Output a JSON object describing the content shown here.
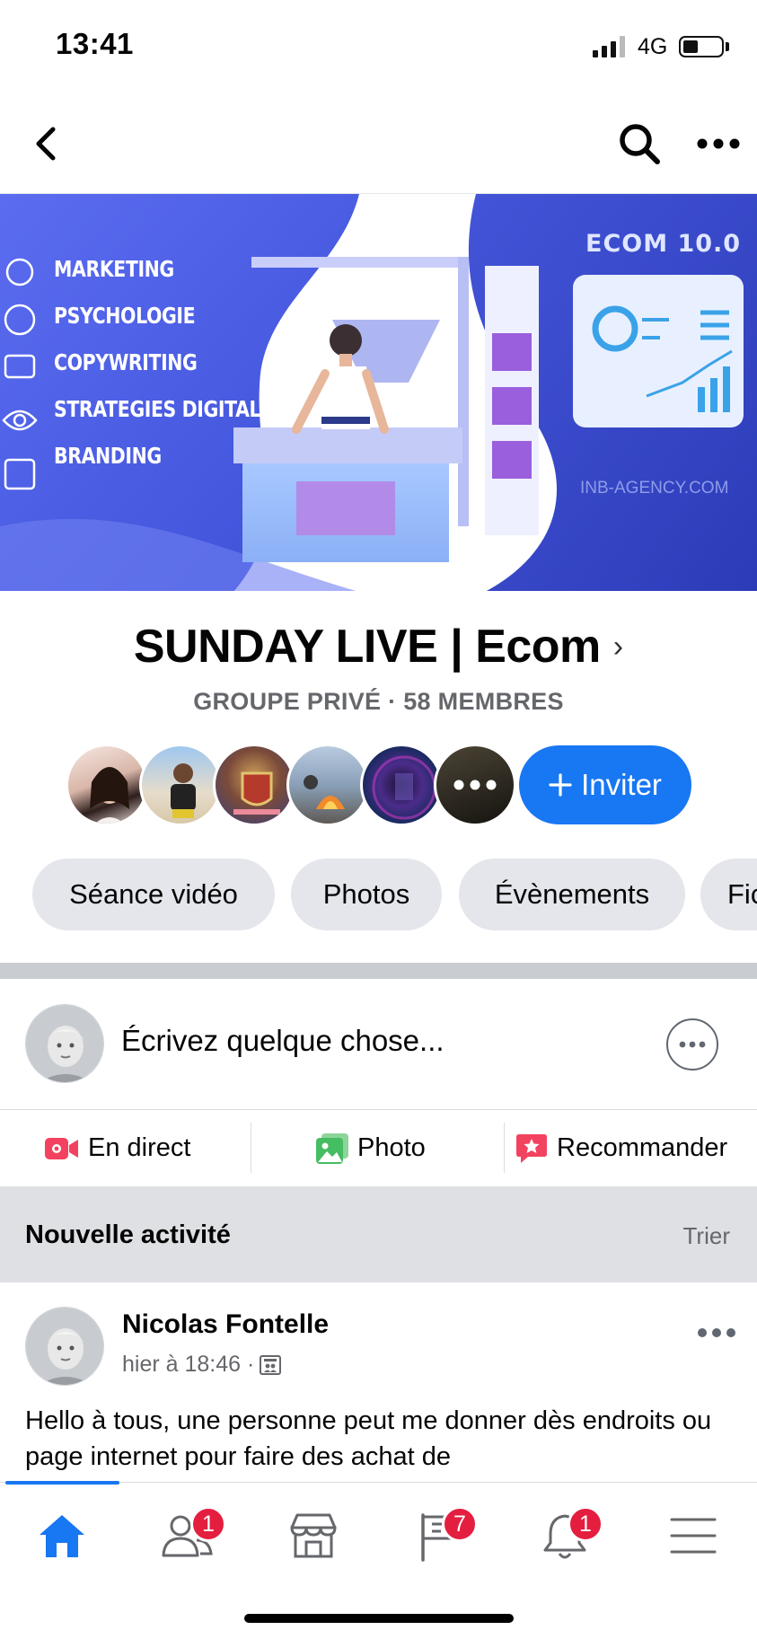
{
  "status_bar": {
    "time": "13:41",
    "network": "4G"
  },
  "cover": {
    "items": [
      "MARKETING",
      "PSYCHOLOGIE",
      "COPYWRITING",
      "STRATEGIES DIGITALES",
      "BRANDING"
    ],
    "badge": "ECOM 10.0",
    "watermark": "INB-AGENCY.COM"
  },
  "group": {
    "name": "SUNDAY LIVE | Ecom",
    "meta": "GROUPE PRIVÉ · 58 MEMBRES",
    "invite_label": "Inviter"
  },
  "chips": [
    "Séance vidéo",
    "Photos",
    "Évènements",
    "Fichiers"
  ],
  "composer": {
    "placeholder": "Écrivez quelque chose..."
  },
  "actions": {
    "live": "En direct",
    "photo": "Photo",
    "recommend": "Recommander"
  },
  "activity": {
    "title": "Nouvelle activité",
    "sort": "Trier"
  },
  "post": {
    "author": "Nicolas Fontelle",
    "time": "hier à 18:46 ·",
    "body": "Hello à tous, une personne peut me donner dès endroits ou page internet pour faire des achat de"
  },
  "tabbar": {
    "badges": {
      "friends": "1",
      "pages": "7",
      "notifications": "1"
    }
  },
  "colors": {
    "accent": "#1877f2",
    "badge": "#e41e3f",
    "live": "#f3425f",
    "photo": "#45bd62"
  }
}
